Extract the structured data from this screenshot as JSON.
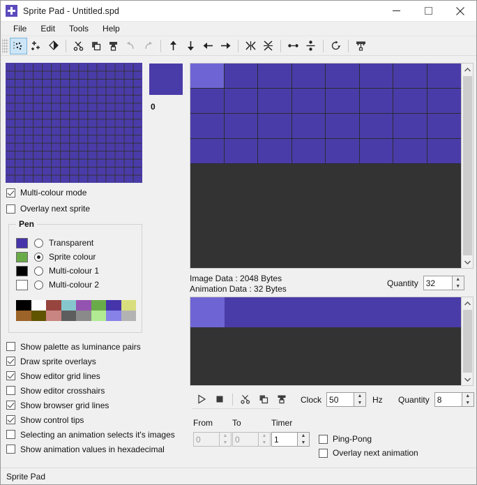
{
  "window": {
    "title": "Sprite Pad - Untitled.spd",
    "app_icon": "plus-square-icon",
    "minimize": "minimize-icon",
    "maximize": "maximize-icon",
    "close": "close-icon"
  },
  "menubar": {
    "items": [
      {
        "label": "File"
      },
      {
        "label": "Edit"
      },
      {
        "label": "Tools"
      },
      {
        "label": "Help"
      }
    ]
  },
  "toolbar": {
    "buttons": [
      {
        "name": "select-tool-icon",
        "active": true
      },
      {
        "name": "add-sprite-icon",
        "active": false
      },
      {
        "name": "fill-tool-icon",
        "active": false
      },
      {
        "name": "cut-icon",
        "active": false
      },
      {
        "name": "copy-icon",
        "active": false
      },
      {
        "name": "paste-icon",
        "active": false
      },
      {
        "name": "undo-icon",
        "active": false
      },
      {
        "name": "redo-icon",
        "active": false
      },
      {
        "name": "shift-up-icon",
        "active": false
      },
      {
        "name": "shift-down-icon",
        "active": false
      },
      {
        "name": "shift-left-icon",
        "active": false
      },
      {
        "name": "shift-right-icon",
        "active": false
      },
      {
        "name": "flip-horizontal-icon",
        "active": false
      },
      {
        "name": "flip-vertical-icon",
        "active": false
      },
      {
        "name": "center-horizontal-icon",
        "active": false
      },
      {
        "name": "center-vertical-icon",
        "active": false
      },
      {
        "name": "rotate-icon",
        "active": false
      },
      {
        "name": "sprite-overlay-icon",
        "active": false
      }
    ]
  },
  "browser": {
    "name": "sprite-browser",
    "grid_cols": 15,
    "grid_rows": 15,
    "cell_color": "#4a3ca8",
    "grid_line_color": "#33313a"
  },
  "preview": {
    "sprite_index": "0",
    "color": "#4a3ca8"
  },
  "options_top": [
    {
      "label": "Multi-colour mode",
      "checked": true,
      "name": "multi-colour-mode"
    },
    {
      "label": "Overlay next sprite",
      "checked": false,
      "name": "overlay-next-sprite"
    }
  ],
  "pen": {
    "title": "Pen",
    "items": [
      {
        "label": "Transparent",
        "swatch": "#4634ab",
        "selected": false
      },
      {
        "label": "Sprite colour",
        "swatch": "#6aab49",
        "selected": true
      },
      {
        "label": "Multi-colour 1",
        "swatch": "#000000",
        "selected": false
      },
      {
        "label": "Multi-colour 2",
        "swatch": "#ffffff",
        "selected": false
      }
    ],
    "palette": [
      "#000000",
      "#fdfdfd",
      "#97453e",
      "#86c7ce",
      "#9453b0",
      "#6aab49",
      "#4634ab",
      "#d8de7c",
      "#9c6428",
      "#615400",
      "#c98581",
      "#5d5d5d",
      "#8a8a8a",
      "#b1ea93",
      "#8782e8",
      "#b3b3b3"
    ]
  },
  "options_bottom": [
    {
      "label": "Show palette as luminance pairs",
      "checked": false,
      "name": "show-palette-luminance-pairs"
    },
    {
      "label": "Draw sprite overlays",
      "checked": true,
      "name": "draw-sprite-overlays"
    },
    {
      "label": "Show editor grid lines",
      "checked": true,
      "name": "show-editor-grid-lines"
    },
    {
      "label": "Show editor crosshairs",
      "checked": false,
      "name": "show-editor-crosshairs"
    },
    {
      "label": "Show browser grid lines",
      "checked": true,
      "name": "show-browser-grid-lines"
    },
    {
      "label": "Show control tips",
      "checked": true,
      "name": "show-control-tips"
    },
    {
      "label": "Selecting an animation selects it's images",
      "checked": false,
      "name": "selecting-animation-selects-images"
    },
    {
      "label": "Show animation values in hexadecimal",
      "checked": false,
      "name": "show-animation-values-hex"
    }
  ],
  "editor": {
    "name": "sprite-editor",
    "cols": 8,
    "rows": 4,
    "cell_color": "#4a3ca8",
    "highlight_color": "#6f64d4",
    "background_color": "#333333",
    "grid_line_color": "#2b2a33"
  },
  "info": {
    "image_data": "Image Data : 2048 Bytes",
    "animation_data": "Animation Data : 32 Bytes",
    "quantity_label": "Quantity",
    "quantity_value": "32"
  },
  "animation": {
    "name": "animation-strip",
    "cell_color": "#4a3ca8",
    "highlight_color": "#6f64d4",
    "background_color": "#333333",
    "controls": [
      {
        "name": "play-icon"
      },
      {
        "name": "stop-icon"
      },
      {
        "name": "cut-icon"
      },
      {
        "name": "copy-icon"
      },
      {
        "name": "paste-icon"
      }
    ],
    "clock_label": "Clock",
    "clock_value": "50",
    "hz_label": "Hz",
    "quantity_label": "Quantity",
    "quantity_value": "8",
    "from_label": "From",
    "from_value": "0",
    "to_label": "To",
    "to_value": "0",
    "timer_label": "Timer",
    "timer_value": "1",
    "ping_pong_label": "Ping-Pong",
    "ping_pong_checked": false,
    "overlay_next_label": "Overlay next animation",
    "overlay_next_checked": false
  },
  "statusbar": {
    "text": "Sprite Pad"
  }
}
